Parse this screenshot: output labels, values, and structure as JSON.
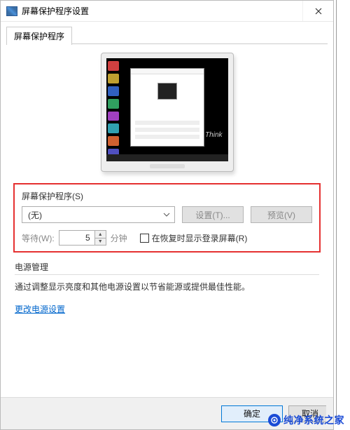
{
  "titlebar": {
    "title": "屏幕保护程序设置"
  },
  "tabs": {
    "main": "屏幕保护程序"
  },
  "screensaver": {
    "section_label": "屏幕保护程序(S)",
    "selected": "(无)",
    "settings_btn": "设置(T)...",
    "preview_btn": "预览(V)",
    "wait_label": "等待(W):",
    "wait_value": "5",
    "wait_unit": "分钟",
    "resume_checkbox": "在恢复时显示登录屏幕(R)"
  },
  "power": {
    "heading": "电源管理",
    "desc": "通过调整显示亮度和其他电源设置以节省能源或提供最佳性能。",
    "link": "更改电源设置"
  },
  "buttons": {
    "ok": "确定",
    "cancel": "取消"
  },
  "watermark": "纯净系统之家"
}
